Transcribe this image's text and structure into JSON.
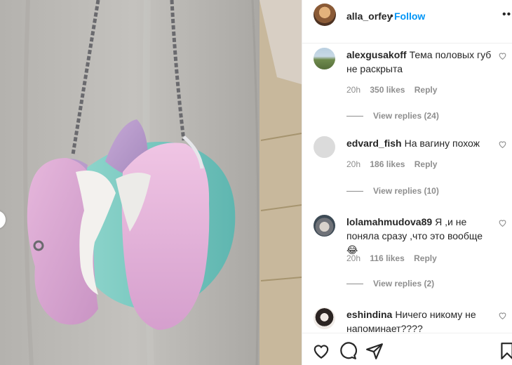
{
  "post": {
    "username": "alla_orfey",
    "separator": "•",
    "follow_label": "Follow",
    "more_icon": "more-options-icon"
  },
  "comments": [
    {
      "username": "alexgusakoff",
      "text": "Тема половых губ не раскрыта",
      "time": "20h",
      "likes": "350 likes",
      "reply_label": "Reply",
      "view_replies": "View replies (24)"
    },
    {
      "username": "edvard_fish",
      "text": "На вагину похож",
      "time": "20h",
      "likes": "186 likes",
      "reply_label": "Reply",
      "view_replies": "View replies (10)"
    },
    {
      "username": "lolamahmudova89",
      "text": "Я ,и не поняла сразу ,что это вообще😂",
      "time": "20h",
      "likes": "116 likes",
      "reply_label": "Reply",
      "view_replies": "View replies (2)"
    },
    {
      "username": "eshindina",
      "text": "Ничего никому не напоминает????"
    }
  ],
  "actions": [
    "heart-icon",
    "comment-icon",
    "share-icon",
    "bookmark-icon"
  ],
  "colors": {
    "link": "#0095f6",
    "text": "#262626",
    "muted": "#8e8e8e",
    "border": "#efefef"
  }
}
